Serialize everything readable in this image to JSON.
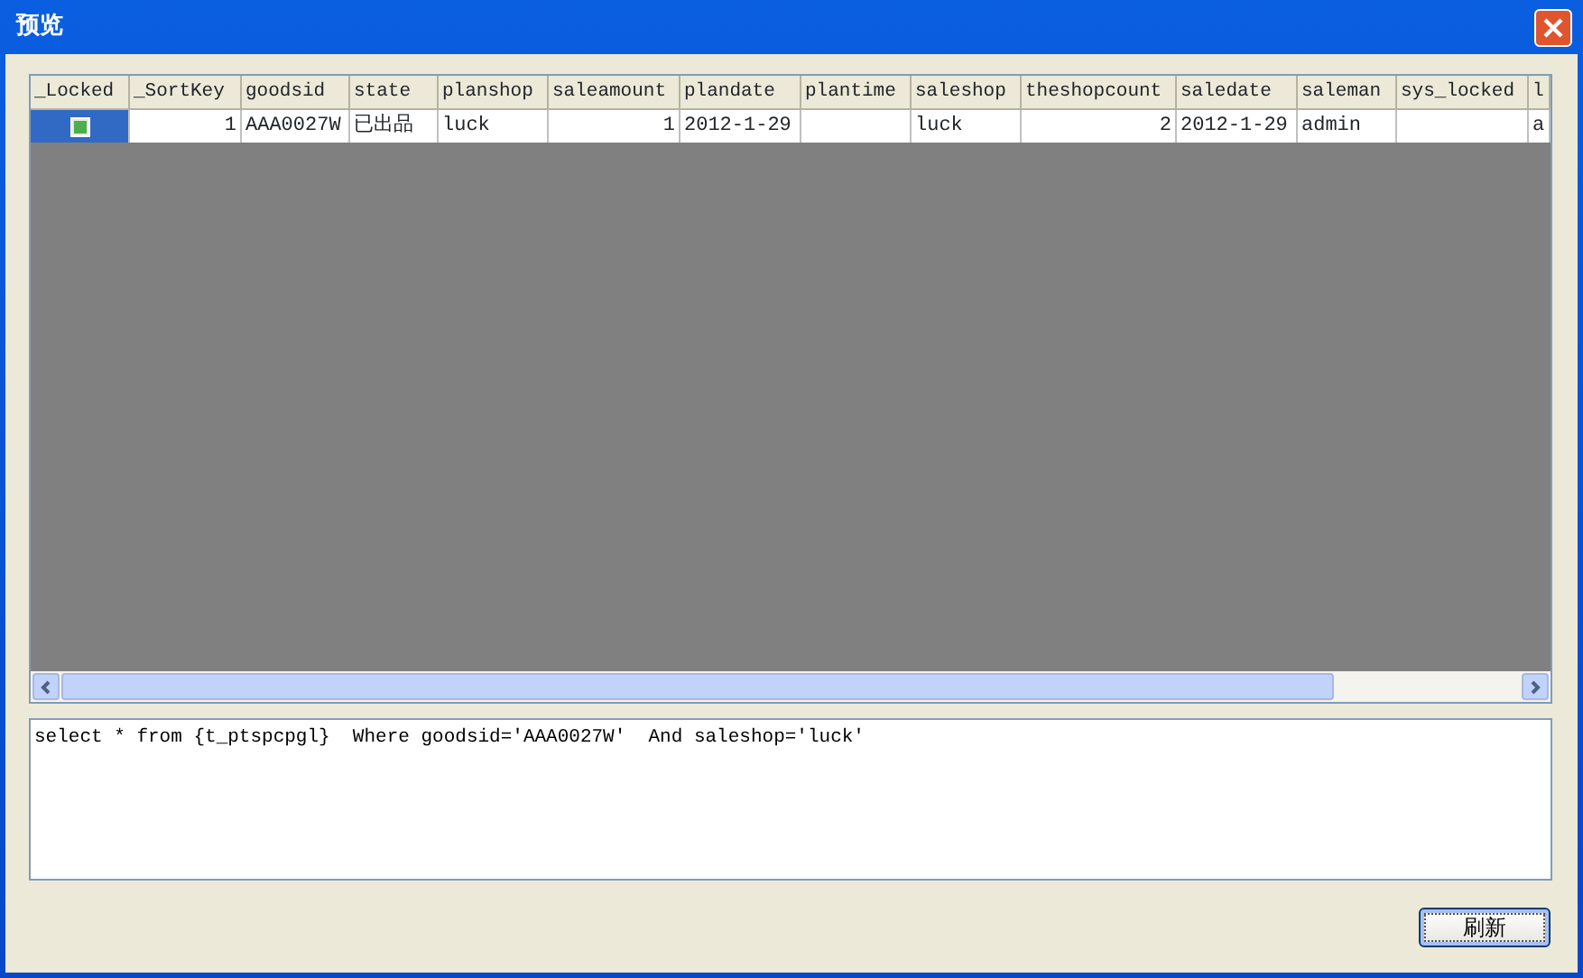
{
  "window": {
    "title": "预览"
  },
  "table": {
    "columns": [
      "_Locked",
      "_SortKey",
      "goodsid",
      "state",
      "planshop",
      "saleamount",
      "plandate",
      "plantime",
      "saleshop",
      "theshopcount",
      "saledate",
      "saleman",
      "sys_locked",
      "l"
    ],
    "rows": [
      {
        "cells": [
          {
            "kind": "checkbox",
            "checked": true,
            "selected": true
          },
          {
            "kind": "number",
            "text": "1"
          },
          {
            "kind": "text",
            "text": "AAA0027W"
          },
          {
            "kind": "text",
            "text": "已出品"
          },
          {
            "kind": "text",
            "text": "luck"
          },
          {
            "kind": "number",
            "text": "1"
          },
          {
            "kind": "text",
            "text": "2012-1-29"
          },
          {
            "kind": "empty"
          },
          {
            "kind": "text",
            "text": "luck"
          },
          {
            "kind": "number",
            "text": "2"
          },
          {
            "kind": "text",
            "text": "2012-1-29"
          },
          {
            "kind": "text",
            "text": "admin"
          },
          {
            "kind": "empty"
          },
          {
            "kind": "text",
            "text": "a"
          }
        ]
      }
    ]
  },
  "sql": {
    "value": "select * from {t_ptspcpgl}  Where goodsid='AAA0027W'  And saleshop='luck'"
  },
  "buttons": [
    {
      "label": "刷新"
    }
  ]
}
